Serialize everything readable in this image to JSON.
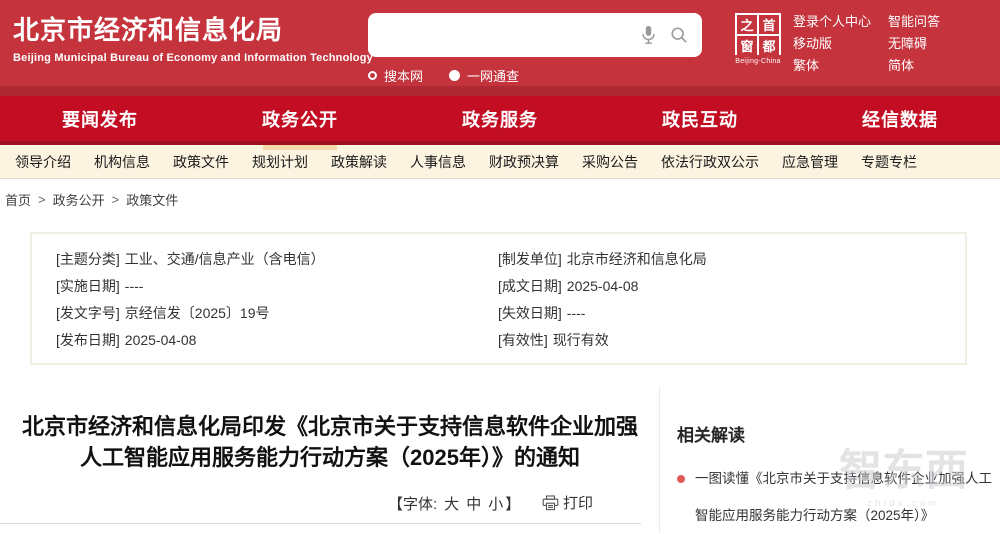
{
  "theme": {
    "header_red": "#c5333d",
    "nav_red": "#c30d23",
    "dark_red_line": "#9c1020",
    "subnav_cream": "#fcf3e0",
    "active_underline": "#f5d9a8",
    "bullet_red": "#e05a5a"
  },
  "header": {
    "title": "北京市经济和信息化局",
    "subtitle": "Beijing Municipal Bureau of Economy and Information Technology",
    "search": {
      "placeholder": "",
      "value": ""
    },
    "search_scopes": [
      {
        "label": "搜本网",
        "filled": false
      },
      {
        "label": "一网通查",
        "filled": true
      }
    ],
    "logo": {
      "chars": [
        "之",
        "首",
        "窗",
        "都"
      ],
      "caption": "Beijing-China"
    },
    "links_col1": [
      "登录个人中心",
      "移动版",
      "繁体"
    ],
    "links_col2": [
      "智能问答",
      "无障碍",
      "简体"
    ]
  },
  "nav": {
    "items": [
      {
        "label": "要闻发布",
        "active": false
      },
      {
        "label": "政务公开",
        "active": true
      },
      {
        "label": "政务服务",
        "active": false
      },
      {
        "label": "政民互动",
        "active": false
      },
      {
        "label": "经信数据",
        "active": false
      }
    ]
  },
  "subnav": {
    "items": [
      "领导介绍",
      "机构信息",
      "政策文件",
      "规划计划",
      "政策解读",
      "人事信息",
      "财政预决算",
      "采购公告",
      "依法行政双公示",
      "应急管理",
      "专题专栏"
    ]
  },
  "breadcrumb": {
    "items": [
      "首页",
      "政务公开",
      "政策文件"
    ],
    "separator": ">"
  },
  "meta": {
    "left": [
      {
        "label": "[主题分类]",
        "value": "工业、交通/信息产业（含电信）"
      },
      {
        "label": "[实施日期]",
        "value": "----"
      },
      {
        "label": "[发文字号]",
        "value": "京经信发〔2025〕19号"
      },
      {
        "label": "[发布日期]",
        "value": "2025-04-08"
      }
    ],
    "right": [
      {
        "label": "[制发单位]",
        "value": "北京市经济和信息化局"
      },
      {
        "label": "[成文日期]",
        "value": "2025-04-08"
      },
      {
        "label": "[失效日期]",
        "value": "----"
      },
      {
        "label": "[有效性]",
        "value": "现行有效"
      }
    ]
  },
  "article": {
    "title": "北京市经济和信息化局印发《北京市关于支持信息软件企业加强人工智能应用服务能力行动方案（2025年）》的通知",
    "font_prefix": "【字体:",
    "font_sizes": [
      "大",
      "中",
      "小"
    ],
    "font_suffix": "】",
    "print_label": "打印"
  },
  "related": {
    "heading": "相关解读",
    "items": [
      "一图读懂《北京市关于支持信息软件企业加强人工智能应用服务能力行动方案（2025年）》"
    ]
  },
  "watermark": {
    "text": "智东西",
    "domain": "zhidx.com"
  }
}
